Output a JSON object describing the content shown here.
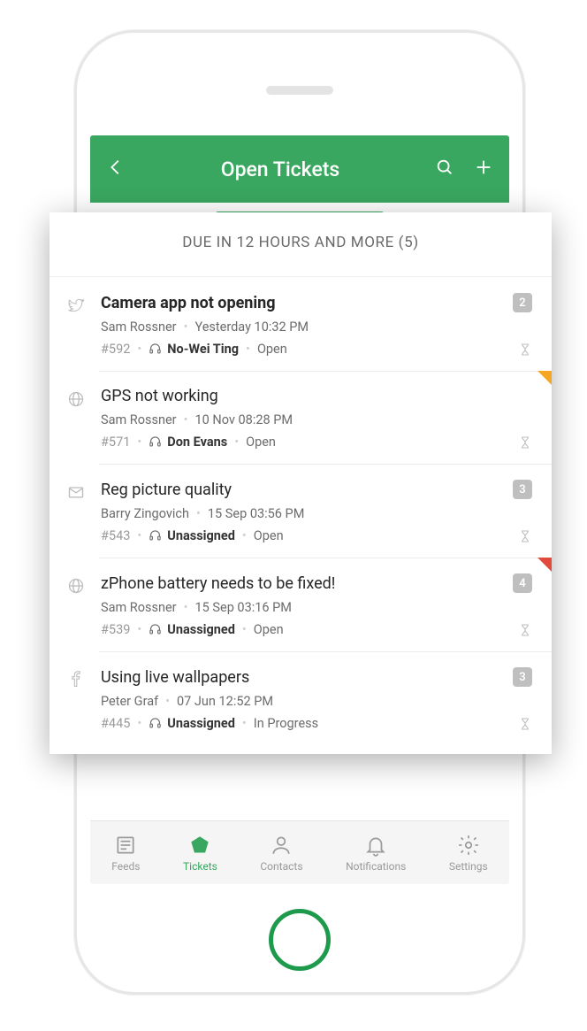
{
  "header": {
    "title": "Open Tickets"
  },
  "section": {
    "label": "DUE IN 12 HOURS AND MORE (5)"
  },
  "tickets": [
    {
      "source": "twitter",
      "title": "Camera app not opening",
      "title_bold": true,
      "requester": "Sam Rossner",
      "timestamp": "Yesterday 10:32 PM",
      "id": "#592",
      "agent": "No-Wei Ting",
      "agent_bold": true,
      "status": "Open",
      "badge": "2",
      "flag": null
    },
    {
      "source": "web",
      "title": "GPS not working",
      "title_bold": false,
      "requester": "Sam Rossner",
      "timestamp": "10 Nov 08:28 PM",
      "id": "#571",
      "agent": "Don Evans",
      "agent_bold": true,
      "status": "Open",
      "badge": null,
      "flag": "orange"
    },
    {
      "source": "email",
      "title": "Reg picture quality",
      "title_bold": false,
      "requester": "Barry Zingovich",
      "timestamp": "15 Sep 03:56 PM",
      "id": "#543",
      "agent": "Unassigned",
      "agent_bold": true,
      "status": "Open",
      "badge": "3",
      "flag": null
    },
    {
      "source": "web",
      "title": "zPhone battery needs to be fixed!",
      "title_bold": false,
      "requester": "Sam Rossner",
      "timestamp": "15 Sep 03:16 PM",
      "id": "#539",
      "agent": "Unassigned",
      "agent_bold": true,
      "status": "Open",
      "badge": "4",
      "flag": "red"
    },
    {
      "source": "facebook",
      "title": "Using live wallpapers",
      "title_bold": false,
      "requester": "Peter Graf",
      "timestamp": "07 Jun 12:52 PM",
      "id": "#445",
      "agent": "Unassigned",
      "agent_bold": true,
      "status": "In Progress",
      "badge": "3",
      "flag": null
    }
  ],
  "bottomnav": {
    "items": [
      {
        "label": "Feeds"
      },
      {
        "label": "Tickets"
      },
      {
        "label": "Contacts"
      },
      {
        "label": "Notifications"
      },
      {
        "label": "Settings"
      }
    ],
    "active_index": 1
  }
}
